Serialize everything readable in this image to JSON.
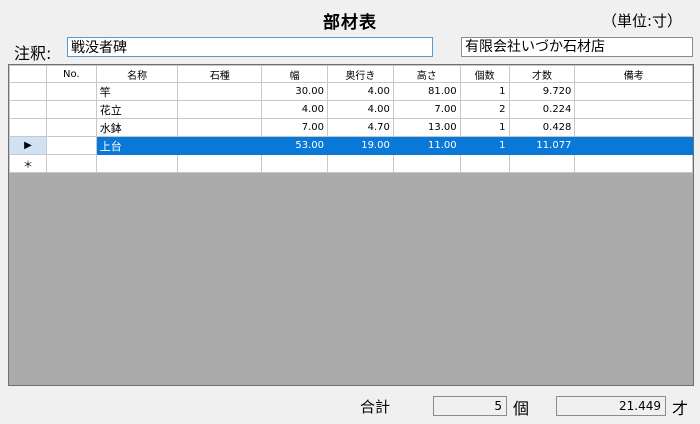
{
  "title": "部材表",
  "unit_label": "（単位:寸）",
  "memo": {
    "label": "注釈:",
    "value": "戦没者碑"
  },
  "shop_name": "有限会社いづか石材店",
  "table": {
    "headers": [
      "No.",
      "名称",
      "石種",
      "幅",
      "奥行き",
      "高さ",
      "個数",
      "才数",
      "備考"
    ],
    "rows": [
      {
        "no": "",
        "name": "竿",
        "stone": "",
        "width": "30.00",
        "depth": "4.00",
        "height": "81.00",
        "count": "1",
        "sai": "9.720",
        "note": ""
      },
      {
        "no": "",
        "name": "花立",
        "stone": "",
        "width": "4.00",
        "depth": "4.00",
        "height": "7.00",
        "count": "2",
        "sai": "0.224",
        "note": ""
      },
      {
        "no": "",
        "name": "水鉢",
        "stone": "",
        "width": "7.00",
        "depth": "4.70",
        "height": "13.00",
        "count": "1",
        "sai": "0.428",
        "note": ""
      },
      {
        "no": "",
        "name": "上台",
        "stone": "",
        "width": "53.00",
        "depth": "19.00",
        "height": "11.00",
        "count": "1",
        "sai": "11.077",
        "note": ""
      }
    ],
    "selected_row_marker": "▶",
    "new_row_marker": "＊"
  },
  "footer": {
    "total_label": "合計",
    "count_value": "5",
    "count_unit": "個",
    "sai_value": "21.449",
    "sai_unit": "才"
  },
  "colors": {
    "selection": "#0a78d7",
    "background": "#f0f0f0",
    "grid_empty": "#ababab"
  }
}
